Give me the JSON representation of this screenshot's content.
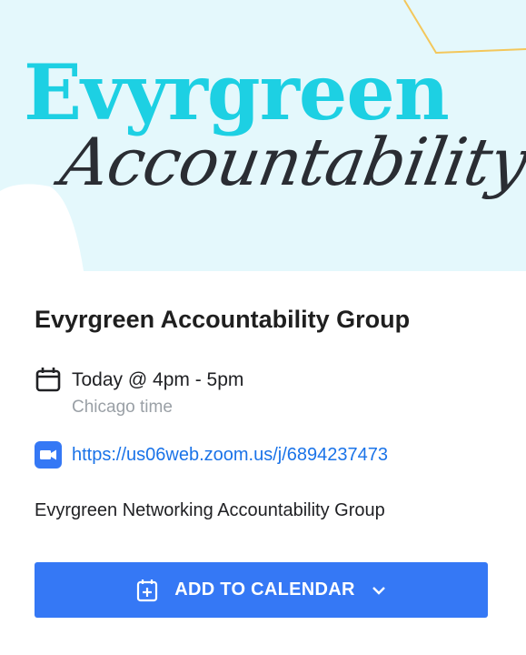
{
  "banner": {
    "brand_title": "Evyrgreen",
    "brand_script": "Accountability Group"
  },
  "event": {
    "title": "Evyrgreen Accountability Group",
    "time": "Today @ 4pm - 5pm",
    "timezone": "Chicago time",
    "link": "https://us06web.zoom.us/j/6894237473",
    "description": "Evyrgreen Networking Accountability Group"
  },
  "actions": {
    "add_to_calendar": "ADD TO CALENDAR"
  },
  "icons": {
    "calendar": "calendar-icon",
    "video": "video-camera-icon",
    "calendar_add": "calendar-plus-icon",
    "dropdown": "chevron-down-icon"
  },
  "colors": {
    "banner_bg": "#e4f8fc",
    "brand_teal": "#1dd0e3",
    "button_blue": "#3578f5",
    "link_blue": "#1a73e8"
  }
}
